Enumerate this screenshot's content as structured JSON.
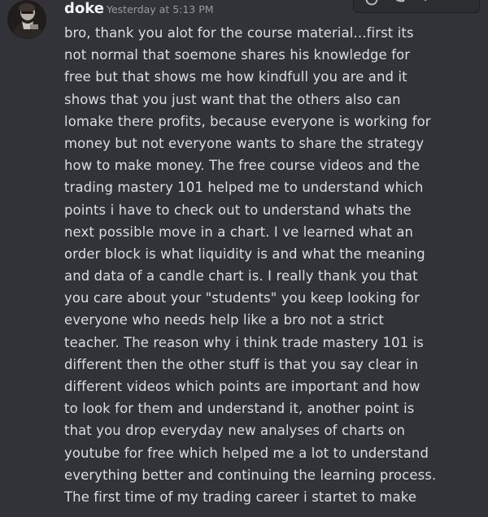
{
  "message": {
    "author": "doke",
    "timestamp": "Yesterday at 5:13 PM",
    "lines": [
      "bro, thank you alot for the course material...first its",
      "not normal that soemone shares his knowledge for",
      "free but that shows me how kindfull you are and it",
      "shows that you just want that the others also can",
      "lomake there profits, because everyone is working for",
      "money but not everyone wants to share the strategy",
      "how to make money. The free course videos and the",
      "trading mastery 101 helped me to understand which",
      "points i have to check out to understand whats the",
      "next possible move in a chart. I ve learned what an",
      "order block is what liquidity is and what the meaning",
      "and data of a candle chart is. I really thank you that",
      "you care about your \"students\" you keep looking for",
      "everyone who needs help like a bro not a strict",
      "teacher. The reason why i think trade mastery 101 is",
      "different then the other stuff is that you say clear in",
      "different videos which points are important and how",
      "to look for them and understand it, another point is",
      "that you drop everyday new analyses of charts on",
      "youtube for free which helped me a lot to understand",
      "everything better and continuing the learning process.",
      "The first time of my trading career i startet to make"
    ]
  },
  "toolbar": {
    "icons": [
      "add-reaction-icon",
      "reply-icon",
      "more-icon"
    ]
  },
  "colors": {
    "background": "#313338",
    "username": "#f2f3f5",
    "timestamp": "#949ba4",
    "text": "#dbdee1"
  }
}
